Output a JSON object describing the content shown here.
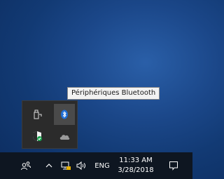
{
  "tooltip": {
    "text": "Périphériques Bluetooth"
  },
  "tray_flyout": {
    "items": [
      {
        "name": "usb-device-icon"
      },
      {
        "name": "bluetooth-icon"
      },
      {
        "name": "windows-defender-icon"
      },
      {
        "name": "onedrive-icon"
      }
    ]
  },
  "taskbar": {
    "language": "ENG",
    "time": "11:33 AM",
    "date": "3/28/2018",
    "icons": [
      "people-icon",
      "chevron-up-icon",
      "network-icon",
      "volume-icon",
      "action-center-icon"
    ]
  },
  "colors": {
    "wallpaper": "#1b4789",
    "taskbar": "#0e1621",
    "flyout": "#2b2b2b",
    "bluetooth": "#1e6fd9"
  }
}
